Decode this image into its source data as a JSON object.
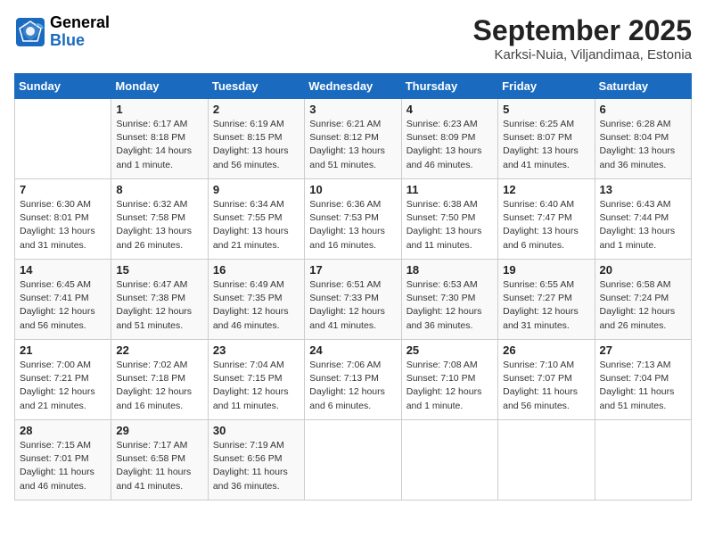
{
  "header": {
    "logo": {
      "line1": "General",
      "line2": "Blue"
    },
    "title": "September 2025",
    "subtitle": "Karksi-Nuia, Viljandimaa, Estonia"
  },
  "days_of_week": [
    "Sunday",
    "Monday",
    "Tuesday",
    "Wednesday",
    "Thursday",
    "Friday",
    "Saturday"
  ],
  "weeks": [
    [
      {
        "day": "",
        "info": ""
      },
      {
        "day": "1",
        "info": "Sunrise: 6:17 AM\nSunset: 8:18 PM\nDaylight: 14 hours\nand 1 minute."
      },
      {
        "day": "2",
        "info": "Sunrise: 6:19 AM\nSunset: 8:15 PM\nDaylight: 13 hours\nand 56 minutes."
      },
      {
        "day": "3",
        "info": "Sunrise: 6:21 AM\nSunset: 8:12 PM\nDaylight: 13 hours\nand 51 minutes."
      },
      {
        "day": "4",
        "info": "Sunrise: 6:23 AM\nSunset: 8:09 PM\nDaylight: 13 hours\nand 46 minutes."
      },
      {
        "day": "5",
        "info": "Sunrise: 6:25 AM\nSunset: 8:07 PM\nDaylight: 13 hours\nand 41 minutes."
      },
      {
        "day": "6",
        "info": "Sunrise: 6:28 AM\nSunset: 8:04 PM\nDaylight: 13 hours\nand 36 minutes."
      }
    ],
    [
      {
        "day": "7",
        "info": "Sunrise: 6:30 AM\nSunset: 8:01 PM\nDaylight: 13 hours\nand 31 minutes."
      },
      {
        "day": "8",
        "info": "Sunrise: 6:32 AM\nSunset: 7:58 PM\nDaylight: 13 hours\nand 26 minutes."
      },
      {
        "day": "9",
        "info": "Sunrise: 6:34 AM\nSunset: 7:55 PM\nDaylight: 13 hours\nand 21 minutes."
      },
      {
        "day": "10",
        "info": "Sunrise: 6:36 AM\nSunset: 7:53 PM\nDaylight: 13 hours\nand 16 minutes."
      },
      {
        "day": "11",
        "info": "Sunrise: 6:38 AM\nSunset: 7:50 PM\nDaylight: 13 hours\nand 11 minutes."
      },
      {
        "day": "12",
        "info": "Sunrise: 6:40 AM\nSunset: 7:47 PM\nDaylight: 13 hours\nand 6 minutes."
      },
      {
        "day": "13",
        "info": "Sunrise: 6:43 AM\nSunset: 7:44 PM\nDaylight: 13 hours\nand 1 minute."
      }
    ],
    [
      {
        "day": "14",
        "info": "Sunrise: 6:45 AM\nSunset: 7:41 PM\nDaylight: 12 hours\nand 56 minutes."
      },
      {
        "day": "15",
        "info": "Sunrise: 6:47 AM\nSunset: 7:38 PM\nDaylight: 12 hours\nand 51 minutes."
      },
      {
        "day": "16",
        "info": "Sunrise: 6:49 AM\nSunset: 7:35 PM\nDaylight: 12 hours\nand 46 minutes."
      },
      {
        "day": "17",
        "info": "Sunrise: 6:51 AM\nSunset: 7:33 PM\nDaylight: 12 hours\nand 41 minutes."
      },
      {
        "day": "18",
        "info": "Sunrise: 6:53 AM\nSunset: 7:30 PM\nDaylight: 12 hours\nand 36 minutes."
      },
      {
        "day": "19",
        "info": "Sunrise: 6:55 AM\nSunset: 7:27 PM\nDaylight: 12 hours\nand 31 minutes."
      },
      {
        "day": "20",
        "info": "Sunrise: 6:58 AM\nSunset: 7:24 PM\nDaylight: 12 hours\nand 26 minutes."
      }
    ],
    [
      {
        "day": "21",
        "info": "Sunrise: 7:00 AM\nSunset: 7:21 PM\nDaylight: 12 hours\nand 21 minutes."
      },
      {
        "day": "22",
        "info": "Sunrise: 7:02 AM\nSunset: 7:18 PM\nDaylight: 12 hours\nand 16 minutes."
      },
      {
        "day": "23",
        "info": "Sunrise: 7:04 AM\nSunset: 7:15 PM\nDaylight: 12 hours\nand 11 minutes."
      },
      {
        "day": "24",
        "info": "Sunrise: 7:06 AM\nSunset: 7:13 PM\nDaylight: 12 hours\nand 6 minutes."
      },
      {
        "day": "25",
        "info": "Sunrise: 7:08 AM\nSunset: 7:10 PM\nDaylight: 12 hours\nand 1 minute."
      },
      {
        "day": "26",
        "info": "Sunrise: 7:10 AM\nSunset: 7:07 PM\nDaylight: 11 hours\nand 56 minutes."
      },
      {
        "day": "27",
        "info": "Sunrise: 7:13 AM\nSunset: 7:04 PM\nDaylight: 11 hours\nand 51 minutes."
      }
    ],
    [
      {
        "day": "28",
        "info": "Sunrise: 7:15 AM\nSunset: 7:01 PM\nDaylight: 11 hours\nand 46 minutes."
      },
      {
        "day": "29",
        "info": "Sunrise: 7:17 AM\nSunset: 6:58 PM\nDaylight: 11 hours\nand 41 minutes."
      },
      {
        "day": "30",
        "info": "Sunrise: 7:19 AM\nSunset: 6:56 PM\nDaylight: 11 hours\nand 36 minutes."
      },
      {
        "day": "",
        "info": ""
      },
      {
        "day": "",
        "info": ""
      },
      {
        "day": "",
        "info": ""
      },
      {
        "day": "",
        "info": ""
      }
    ]
  ]
}
